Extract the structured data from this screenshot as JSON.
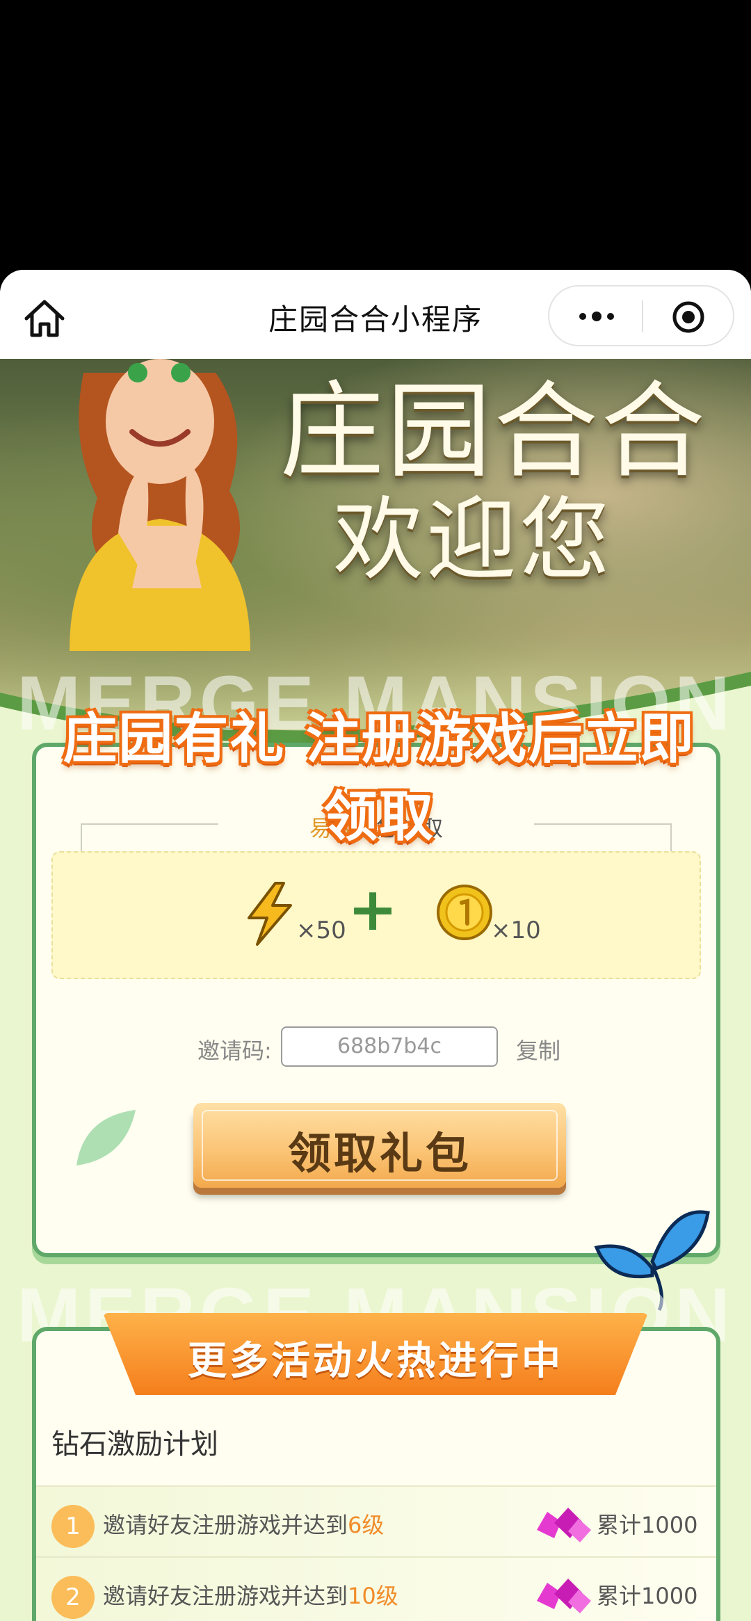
{
  "nav": {
    "title": "庄园合合小程序"
  },
  "hero": {
    "title_line1": "庄园合合",
    "title_line2": "欢迎您",
    "watermark": "MERGE MANSION"
  },
  "gift": {
    "banner": "庄园有礼 注册游戏后立即领取",
    "inviter_name": "易敏",
    "inviter_suffix": "邀您领取",
    "rewards": [
      {
        "icon": "lightning-icon",
        "qty": "×50"
      },
      {
        "icon": "coin-icon",
        "qty": "×10"
      }
    ],
    "plus": "+",
    "code_label": "邀请码:",
    "code_value": "688b7b4c",
    "copy_label": "复制",
    "claim_label": "领取礼包"
  },
  "activities": {
    "banner": "更多活动火热进行中",
    "section_title": "钻石激励计划",
    "tasks": [
      {
        "num": "1",
        "text": "邀请好友注册游戏并达到",
        "level": "6级",
        "reward": "累计1000"
      },
      {
        "num": "2",
        "text": "邀请好友注册游戏并达到",
        "level": "10级",
        "reward": "累计1000"
      }
    ]
  },
  "colors": {
    "accent_orange": "#f47e1c",
    "card_border": "#5fa86a",
    "level_text": "#f08c2a"
  }
}
